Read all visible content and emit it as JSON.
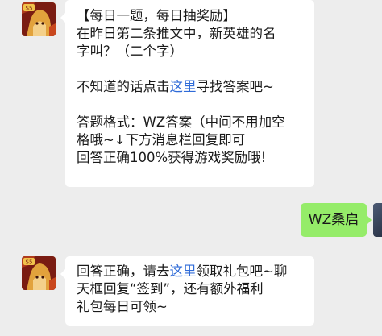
{
  "messages": [
    {
      "side": "left",
      "lines": [
        {
          "text": "【每日一题，每日抽奖励】"
        },
        {
          "text": "在昨日第二条推文中，新英雄的名"
        },
        {
          "text": "字叫？（二个字）"
        },
        {
          "text": ""
        },
        {
          "before": "不知道的话点击",
          "link": "这里",
          "after": "寻找答案吧~"
        },
        {
          "text": ""
        },
        {
          "text": "答题格式：WZ答案（中间不用加空"
        },
        {
          "text": "格哦~↓下方消息栏回复即可"
        },
        {
          "text": "回答正确100%获得游戏奖励哦!"
        }
      ]
    },
    {
      "side": "right",
      "text": "WZ桑启"
    },
    {
      "side": "left",
      "lines": [
        {
          "before": "回答正确，请去",
          "link": "这里",
          "after": "领取礼包吧~聊"
        },
        {
          "text": "天框回复“签到”，还有额外福利"
        },
        {
          "text": "礼包每日可领~"
        }
      ]
    }
  ],
  "avatar_badge": "S5",
  "colors": {
    "background": "#ededed",
    "bubble_left": "#ffffff",
    "bubble_right": "#95ec69",
    "link": "#2f6bd8"
  },
  "icons": {
    "left_avatar": "game-hero-avatar-icon",
    "right_avatar": "user-avatar-icon"
  }
}
